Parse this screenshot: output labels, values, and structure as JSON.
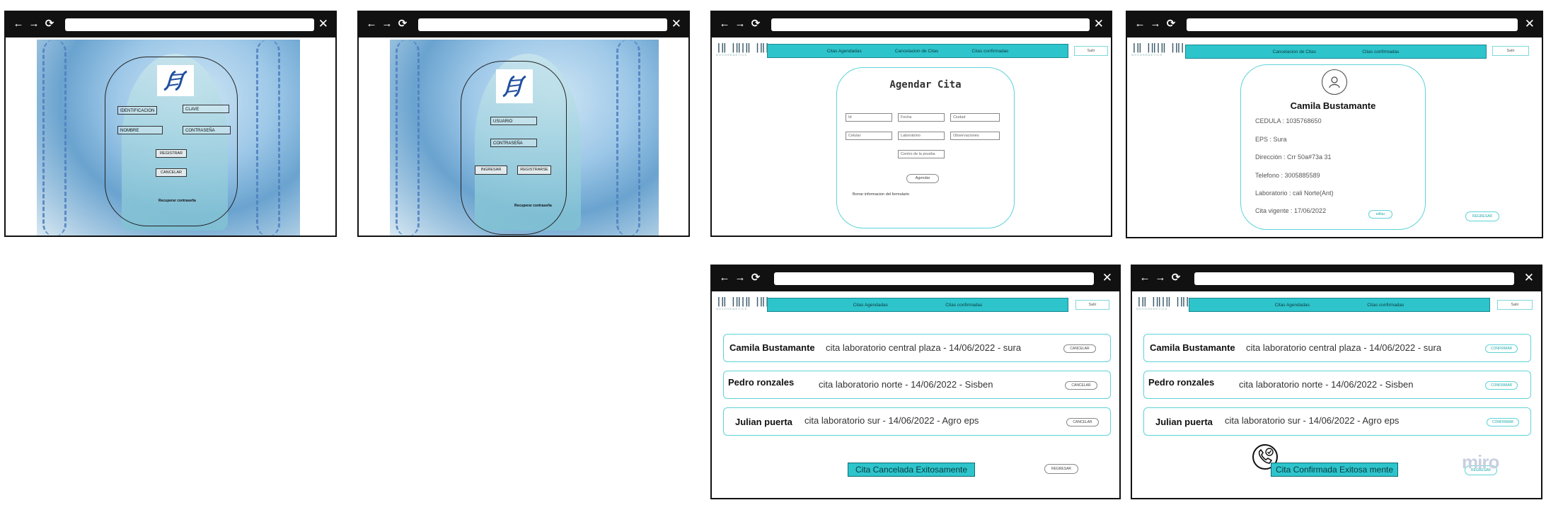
{
  "browser": {
    "back": "←",
    "forward": "→",
    "reload": "⟳",
    "close": "✕"
  },
  "login1": {
    "fields": [
      "IDENTIFICACION",
      "CLAVE",
      "NOMBRE",
      "CONTRASEÑA"
    ],
    "buttons": [
      "REGISTRAR",
      "CANCELAR"
    ],
    "link": "Recuperar contraseña"
  },
  "login2": {
    "fields": [
      "USUARIO",
      "CONTRASEÑA"
    ],
    "buttons": [
      "INGRESAR",
      "REGISTRARSE"
    ],
    "link": "Recuperar contraseña"
  },
  "brand": {
    "bars": "|‖ |‖|‖ |‖|",
    "sub": "NOVOGENETICS"
  },
  "agendar": {
    "nav": [
      "Citas Agendadas",
      "Cancelacion de Citas",
      "Citas confirmadas"
    ],
    "salir": "Salir",
    "title": "Agendar Cita",
    "fields": [
      "Id",
      "Fecha",
      "Ciudad",
      "Celular",
      "Laboratorio",
      "Observaciones",
      "Centro de la prueba"
    ],
    "submit": "Agendar",
    "note": "Borrar informacion del formulario"
  },
  "perfil": {
    "nav": [
      "Cancelacion de Citas",
      "Citas confirmadas"
    ],
    "salir": "Salir",
    "name": "Camila Bustamante",
    "lines": [
      "CEDULA : 1035768650",
      "EPS : Sura",
      "Dirección : Crr 50a#73a 31",
      "Telefono : 3005885589",
      "Laboratorio : cali  Norte(Ant)",
      "Cita vigente : 17/06/2022"
    ],
    "edit": "editar",
    "back": "REGRESAR"
  },
  "cancelar": {
    "nav": [
      "Citas Agendadas",
      "Citas confirmadas"
    ],
    "salir": "Salir",
    "rows": [
      {
        "name": "Camila Bustamante",
        "detail": "cita laboratorio central plaza - 14/06/2022 -   sura",
        "action": "CANCELAR"
      },
      {
        "name": "Pedro ronzales",
        "detail": "cita laboratorio norte -   14/06/2022 -   Sisben",
        "action": "CANCELAR"
      },
      {
        "name": "Julian puerta",
        "detail": "cita laboratorio sur - 14/06/2022 -   Agro eps",
        "action": "CANCELAR"
      }
    ],
    "banner": "Cita Cancelada Exitosamente",
    "back": "REGRESAR"
  },
  "confirmar": {
    "nav": [
      "Citas Agendadas",
      "Citas confirmadas"
    ],
    "salir": "Salir",
    "rows": [
      {
        "name": "Camila Bustamante",
        "detail": "cita laboratorio central plaza - 14/06/2022 -   sura",
        "action": "CONFIRMAR"
      },
      {
        "name": "Pedro ronzales",
        "detail": "cita laboratorio norte -   14/06/2022 -   Sisben",
        "action": "CONFIRMAR"
      },
      {
        "name": "Julian puerta",
        "detail": "cita laboratorio sur - 14/06/2022 -   Agro eps",
        "action": "CONFIRMAR"
      }
    ],
    "banner": "Cita Confirmada Exitosa mente",
    "back": "REGRESAR"
  },
  "watermark": "miro",
  "colors": {
    "teal": "#2ec4cc",
    "teal_border": "#5fd2d8",
    "chrome": "#111111"
  }
}
